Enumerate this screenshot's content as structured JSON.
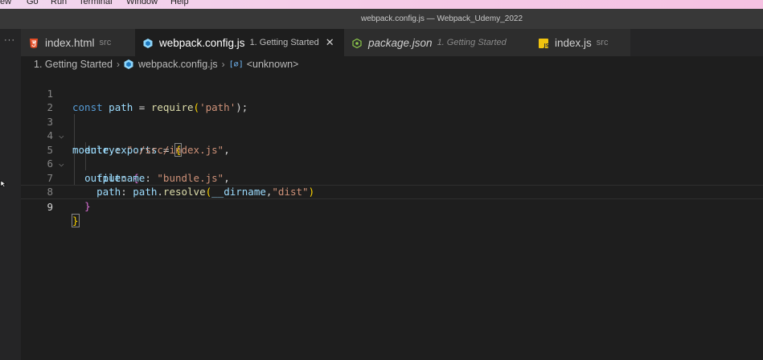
{
  "menu": [
    "ew",
    "Go",
    "Run",
    "Terminal",
    "Window",
    "Help"
  ],
  "window_title": "webpack.config.js — Webpack_Udemy_2022",
  "activity": {
    "more": "···"
  },
  "tabs": [
    {
      "name": "index.html",
      "desc": "src",
      "icon": "html-file-icon",
      "active": false
    },
    {
      "name": "webpack.config.js",
      "desc": "1. Getting Started",
      "icon": "webpack-file-icon",
      "active": true,
      "close": "✕"
    },
    {
      "name": "package.json",
      "desc": "1. Getting Started",
      "icon": "nodejs-file-icon",
      "active": false
    },
    {
      "name": "index.js",
      "desc": "src",
      "icon": "js-file-icon",
      "active": false
    }
  ],
  "breadcrumb": {
    "folder": "1. Getting Started",
    "file": "webpack.config.js",
    "symbol_glyph": "[∅]",
    "symbol": "<unknown>"
  },
  "editor": {
    "line_numbers": [
      "1",
      "2",
      "3",
      "4",
      "5",
      "6",
      "7",
      "8",
      "9"
    ],
    "current_line": 9,
    "code": {
      "l1_const": "const",
      "l1_path": "path",
      "l1_eq": " = ",
      "l1_require": "require",
      "l1_open": "(",
      "l1_str": "'path'",
      "l1_close": ");",
      "l3_module": "module",
      "l3_dot": ".",
      "l3_exports": "exports",
      "l3_eq": " = ",
      "l3_brace": "{",
      "l4_key": "entry",
      "l4_colon": ": ",
      "l4_str": "\"./src/index.js\"",
      "l4_comma": ",",
      "l5_key": "output",
      "l5_colon": ": ",
      "l5_brace": "{",
      "l6_key": "filename",
      "l6_colon": ": ",
      "l6_str": "\"bundle.js\"",
      "l6_comma": ",",
      "l7_key": "path",
      "l7_colon": ": ",
      "l7_obj": "path",
      "l7_dot": ".",
      "l7_fn": "resolve",
      "l7_open": "(",
      "l7_dirname": "__dirname",
      "l7_comma": ",",
      "l7_str": "\"dist\"",
      "l7_close": ")",
      "l8_brace": "}",
      "l9_brace": "}"
    }
  },
  "colors": {
    "keyword": "#569cd6",
    "variable": "#9cdcfe",
    "function": "#dcdcaa",
    "string": "#ce9178",
    "bracket1": "#ffd700",
    "bracket2": "#da70d6",
    "html_icon": "#e44d26",
    "js_icon": "#f1c40f",
    "node_icon": "#8cc84b",
    "webpack_icon": "#8ed6fb"
  }
}
